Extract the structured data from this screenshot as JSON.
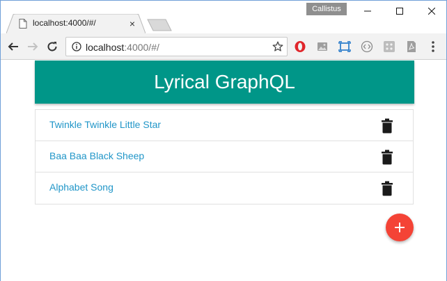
{
  "browser": {
    "profile_name": "Callistus",
    "tab": {
      "title": "localhost:4000/#/",
      "close_glyph": "×"
    },
    "address": {
      "host": "localhost",
      "path": ":4000/#/"
    },
    "icons": {
      "minimize": "minimize-icon",
      "maximize": "maximize-icon",
      "close": "close-icon",
      "back": "back-arrow-icon",
      "forward": "forward-arrow-icon",
      "reload": "reload-icon",
      "info": "info-icon",
      "bookmark": "star-icon",
      "extensions": [
        "opera-icon",
        "image-icon",
        "screen-capture-icon",
        "code-icon",
        "grid-icon",
        "pdf-icon"
      ],
      "menu": "more-vertical-icon"
    }
  },
  "app": {
    "title": "Lyrical GraphQL",
    "header_color": "#009688",
    "link_color": "#2196c8",
    "songs": [
      {
        "title": "Twinkle Twinkle Little Star"
      },
      {
        "title": "Baa Baa Black Sheep"
      },
      {
        "title": "Alphabet Song"
      }
    ],
    "add_button": {
      "glyph": "+",
      "color": "#f44336"
    }
  }
}
